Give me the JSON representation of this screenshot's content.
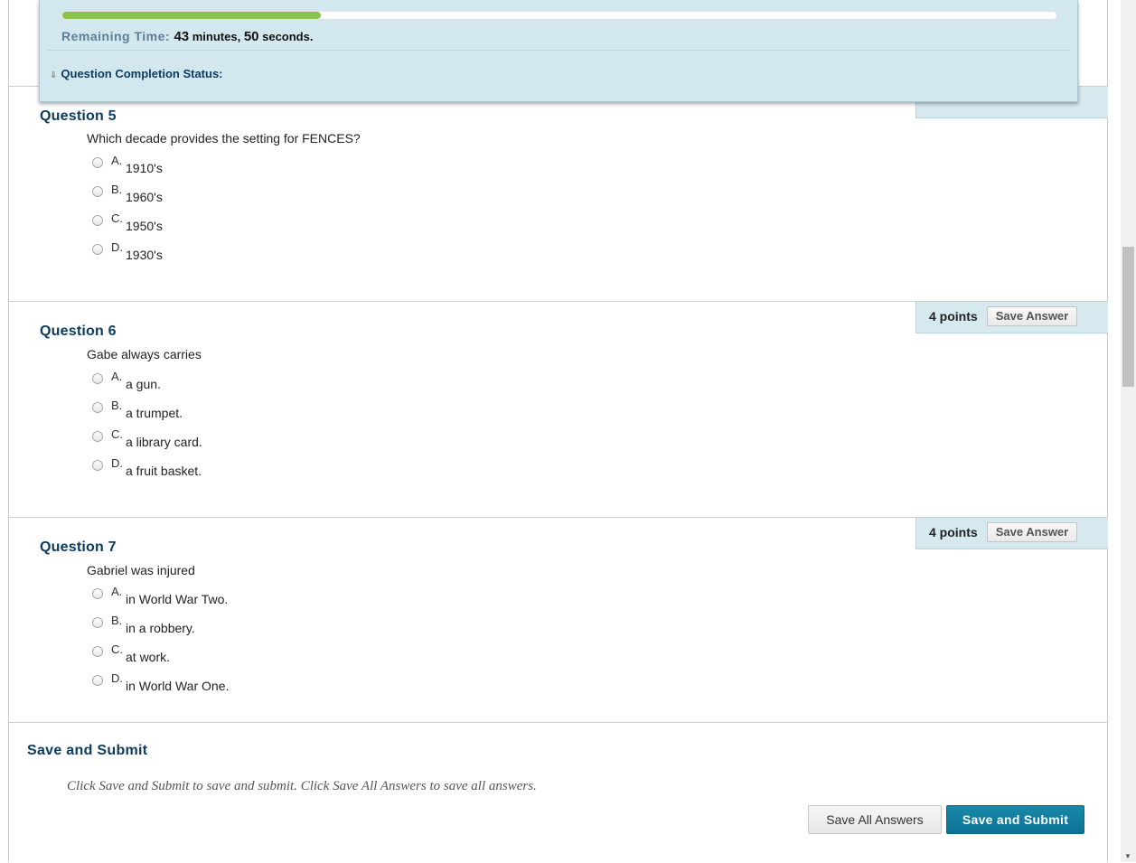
{
  "timer": {
    "progress_fraction": 0.26,
    "label": "Remaining Time:",
    "value_parts": [
      "43",
      " minutes, ",
      "50",
      " seconds."
    ],
    "completion_status_label": "Question Completion Status:"
  },
  "questions": [
    {
      "title": "Question 5",
      "text": "Which decade provides the setting for FENCES?",
      "options": [
        {
          "letter": "A.",
          "text": "1910's"
        },
        {
          "letter": "B.",
          "text": "1960's"
        },
        {
          "letter": "C.",
          "text": "1950's"
        },
        {
          "letter": "D.",
          "text": "1930's"
        }
      ]
    },
    {
      "title": "Question 6",
      "text": "Gabe always carries",
      "points": "4 points",
      "save_label": "Save Answer",
      "options": [
        {
          "letter": "A.",
          "text": "a gun."
        },
        {
          "letter": "B.",
          "text": "a trumpet."
        },
        {
          "letter": "C.",
          "text": "a library card."
        },
        {
          "letter": "D.",
          "text": "a fruit basket."
        }
      ]
    },
    {
      "title": "Question 7",
      "text": "Gabriel was injured",
      "points": "4 points",
      "save_label": "Save Answer",
      "options": [
        {
          "letter": "A.",
          "text": "in World War Two."
        },
        {
          "letter": "B.",
          "text": "in a robbery."
        },
        {
          "letter": "C.",
          "text": "at work."
        },
        {
          "letter": "D.",
          "text": "in World War One."
        }
      ]
    }
  ],
  "submit": {
    "title": "Save and Submit",
    "instructions": "Click Save and Submit to save and submit. Click Save All Answers to save all answers.",
    "save_all_label": "Save All Answers",
    "submit_label": "Save and Submit"
  },
  "colors": {
    "accent": "#0b7294",
    "heading": "#0d3c61",
    "panel_bg": "#d2e8ee",
    "progress": "#8cc34a"
  }
}
